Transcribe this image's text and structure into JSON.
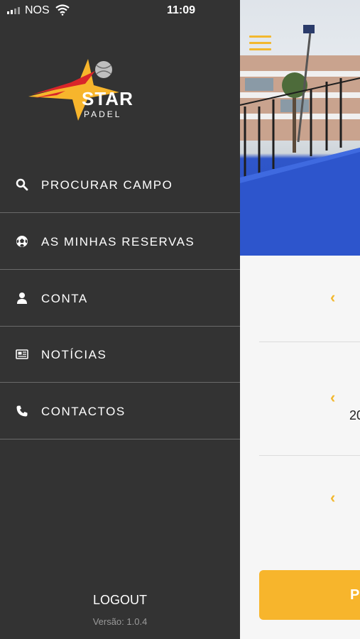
{
  "status_bar": {
    "carrier": "NOS",
    "time": "11:09"
  },
  "brand": {
    "name": "STAR",
    "sub": "PADEL",
    "colors": {
      "yellow": "#f7b52c",
      "red": "#d9252a"
    }
  },
  "menu": [
    {
      "icon": "search-icon",
      "label": "PROCURAR CAMPO"
    },
    {
      "icon": "soccer-ball-icon",
      "label": "AS MINHAS RESERVAS"
    },
    {
      "icon": "user-icon",
      "label": "CONTA"
    },
    {
      "icon": "newspaper-icon",
      "label": "NOTÍCIAS"
    },
    {
      "icon": "phone-icon",
      "label": "CONTACTOS"
    }
  ],
  "footer": {
    "logout": "LOGOUT",
    "version": "Versão: 1.0.4"
  },
  "background": {
    "partial_number": "20",
    "button_initial": "P"
  },
  "colors": {
    "drawer_bg": "#333333",
    "accent": "#f2b82f",
    "court_blue": "#2a4fc4"
  }
}
